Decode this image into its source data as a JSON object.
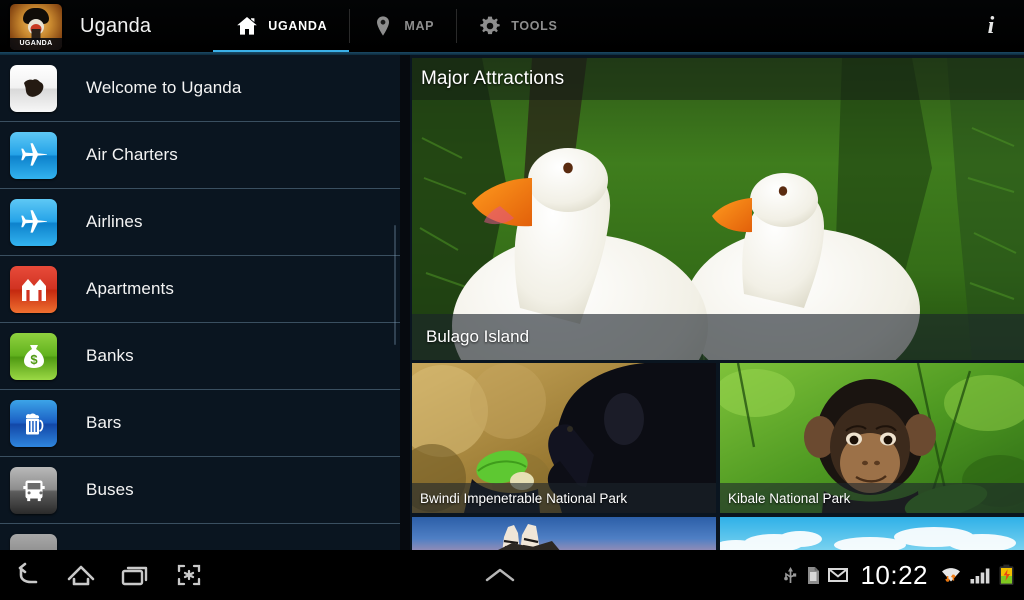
{
  "actionbar": {
    "app_icon_label": "UGANDA",
    "title": "Uganda",
    "info_icon": "info-icon",
    "info_glyph": "i",
    "tabs": [
      {
        "label": "UGANDA",
        "icon": "home-icon",
        "active": true
      },
      {
        "label": "MAP",
        "icon": "map-pin-icon",
        "active": false
      },
      {
        "label": "TOOLS",
        "icon": "gear-icon",
        "active": false
      }
    ],
    "accent_color": "#3ab0e8",
    "active_text_color": "#ffffff",
    "inactive_text_color": "#8e8e8e"
  },
  "sidebar": {
    "background_color": "#0a1520",
    "divider_color": "#3a4f60",
    "items": [
      {
        "label": "Welcome to Uganda",
        "icon": "uganda-map-icon",
        "theme": "white"
      },
      {
        "label": "Air Charters",
        "icon": "airplane-icon",
        "theme": "blue"
      },
      {
        "label": "Airlines",
        "icon": "airplane-icon",
        "theme": "blue"
      },
      {
        "label": "Apartments",
        "icon": "apartment-building-icon",
        "theme": "red"
      },
      {
        "label": "Banks",
        "icon": "money-bag-icon",
        "theme": "green"
      },
      {
        "label": "Bars",
        "icon": "beer-mug-icon",
        "theme": "bluedark"
      },
      {
        "label": "Buses",
        "icon": "bus-icon",
        "theme": "gray"
      },
      {
        "label": "",
        "icon": "partial-item-icon",
        "theme": "gray2"
      }
    ]
  },
  "content": {
    "hero": {
      "section_title": "Major Attractions",
      "caption": "Bulago Island",
      "photo": "two-white-geese-on-green-grass"
    },
    "thumbnails": [
      {
        "caption": "Bwindi Impenetrable National Park",
        "photo": "gorilla-holding-green-leaf"
      },
      {
        "caption": "Kibale National Park",
        "photo": "young-chimpanzee-in-foliage"
      },
      {
        "caption": "",
        "photo": "zebras-against-blue-sky"
      },
      {
        "caption": "",
        "photo": "blue-sky-with-clouds"
      }
    ]
  },
  "systembar": {
    "nav": [
      {
        "icon": "back-icon",
        "name": "back-button"
      },
      {
        "icon": "home-icon",
        "name": "home-button"
      },
      {
        "icon": "recent-apps-icon",
        "name": "recent-apps-button"
      },
      {
        "icon": "screenshot-icon",
        "name": "screenshot-button"
      }
    ],
    "show_keyboard_icon": "chevron-up-icon",
    "status": {
      "usb_icon": "usb-icon",
      "sdcard_icon": "sd-card-icon",
      "mail_icon": "mail-icon",
      "clock": "10:22",
      "wifi_icon": "wifi-icon",
      "signal_icon": "cell-signal-icon",
      "battery_icon": "battery-icon"
    }
  }
}
